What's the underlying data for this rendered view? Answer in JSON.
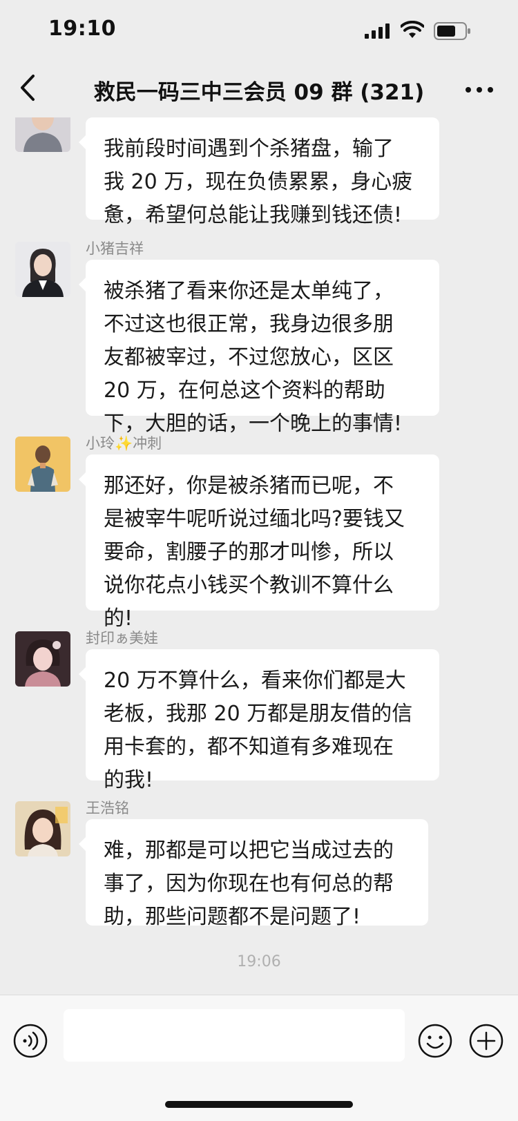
{
  "status_bar": {
    "time": "19:10"
  },
  "nav": {
    "title": "救民一码三中三会员 09 群 (321)"
  },
  "messages": [
    {
      "sender": "",
      "text": "我前段时间遇到个杀猪盘，输了\n我 20 万，现在负债累累，身心疲\n惫，希望何总能让我赚到钱还债!"
    },
    {
      "sender": "小猪吉祥",
      "text": "被杀猪了看来你还是太单纯了，\n不过这也很正常，我身边很多朋\n友都被宰过，不过您放心，区区\n20 万，在何总这个资料的帮助\n下，大胆的话，一个晚上的事情!"
    },
    {
      "sender": "小玲✨冲刺",
      "text": "那还好，你是被杀猪而已呢，不\n是被宰牛呢听说过缅北吗?要钱又\n要命，割腰子的那才叫惨，所以\n说你花点小钱买个教训不算什么\n的!"
    },
    {
      "sender": "封印ぁ美娃",
      "text": "20 万不算什么，看来你们都是大\n老板，我那 20 万都是朋友借的信\n用卡套的，都不知道有多难现在\n的我!"
    },
    {
      "sender": "王浩铭",
      "text": "难，那都是可以把它当成过去的\n事了，因为你现在也有何总的帮\n助，那些问题都不是问题了!"
    }
  ],
  "timestamp": "19:06",
  "input": {
    "value": ""
  },
  "colors": {
    "background": "#ededed",
    "bubble": "#ffffff",
    "input_bar": "#f7f7f7",
    "sender_name": "#8a8a8a"
  },
  "icons": [
    "signal-icon",
    "wifi-icon",
    "battery-icon",
    "back-icon",
    "more-icon",
    "voice-icon",
    "emoji-icon",
    "plus-icon"
  ]
}
